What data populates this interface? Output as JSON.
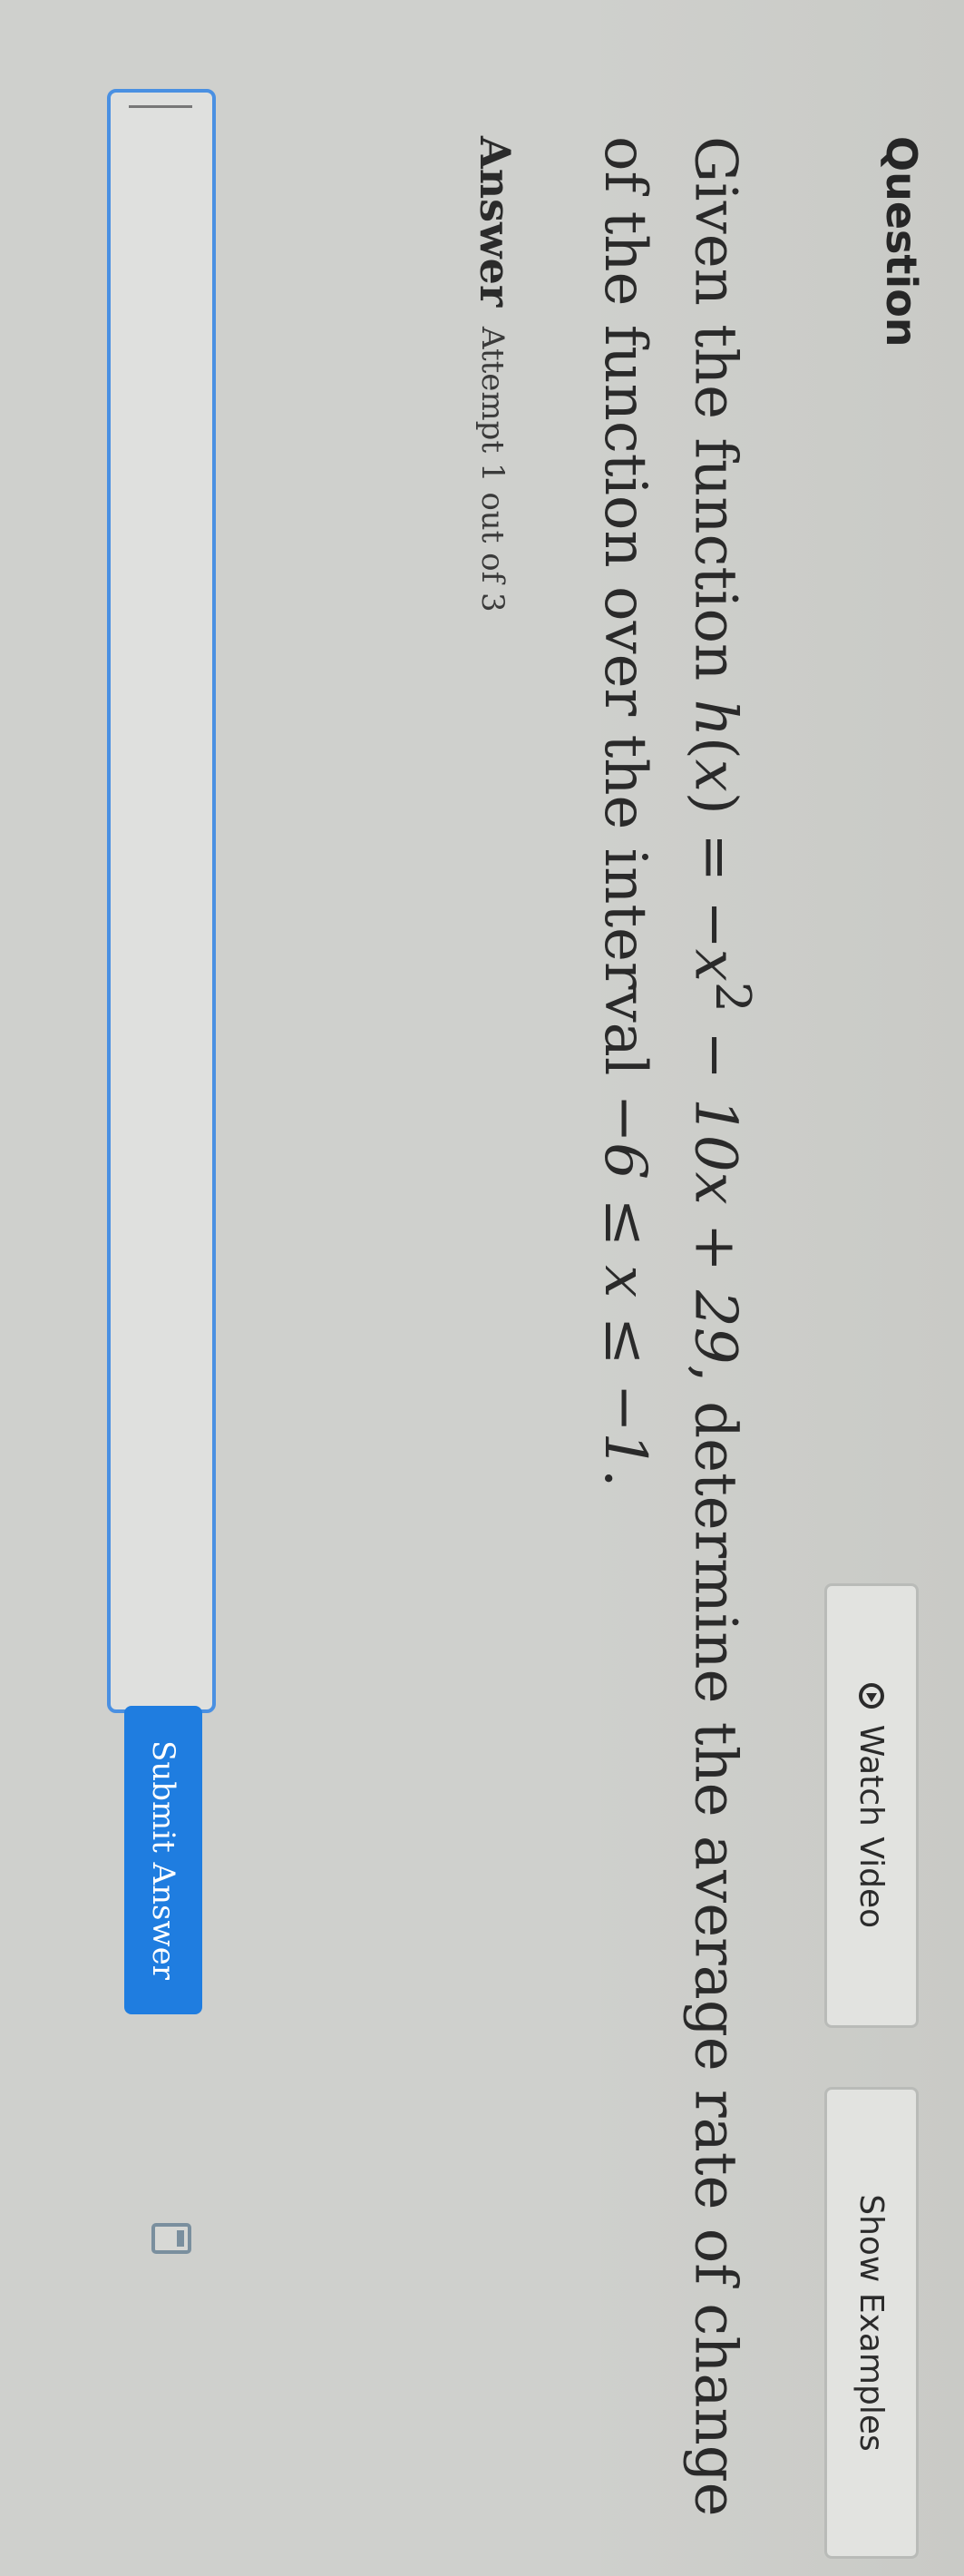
{
  "header": {
    "question_label": "Question",
    "watch_video_label": "Watch Video",
    "show_examples_label": "Show Examples"
  },
  "question": {
    "prefix": "Given the function ",
    "function_name": "h",
    "function_var": "x",
    "expr_part1": " = −x",
    "exponent": "2",
    "expr_part2": " − 10x + 29",
    "middle": ", determine the average rate of change of the function over the interval ",
    "interval": "−6 ≤ x ≤ −1",
    "suffix": "."
  },
  "answer": {
    "label": "Answer",
    "attempt_text": "Attempt 1 out of 3",
    "input_value": "",
    "submit_label": "Submit Answer"
  },
  "colors": {
    "accent": "#1f7de0",
    "input_border": "#4a90e2"
  },
  "icons": {
    "play": "play-circle-icon",
    "calculator": "calculator-icon"
  }
}
